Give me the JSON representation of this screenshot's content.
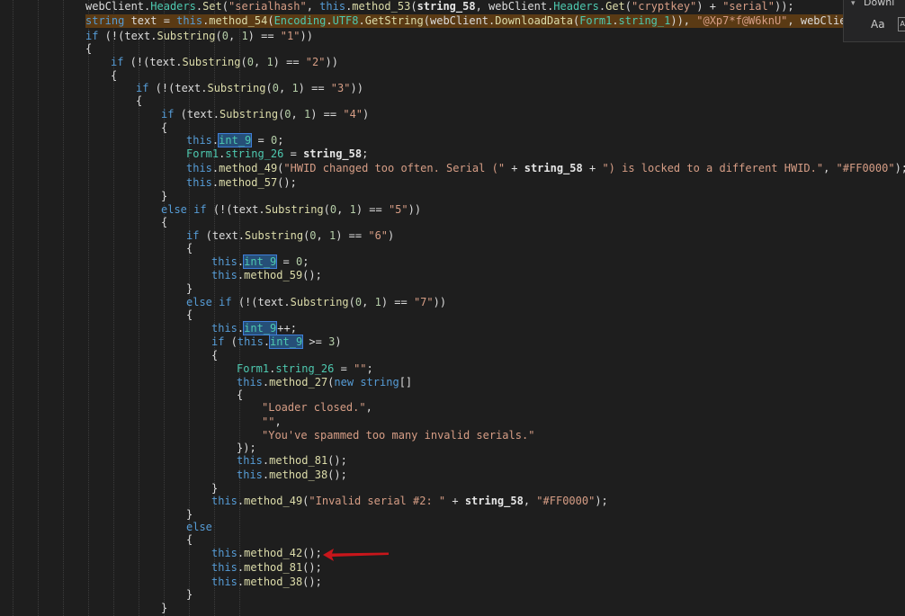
{
  "find_widget": {
    "chevron": "chevron-down-icon",
    "label": "Downl",
    "match_case": "Aa",
    "whole_word": "AB"
  },
  "code": {
    "lines": [
      [
        "webClient",
        ".",
        "Headers",
        ".",
        "Set",
        "(",
        "\"serialhash\"",
        ", ",
        "this",
        ".",
        "method_53",
        "(",
        "string_58",
        ", webClient.",
        "Headers",
        ".",
        "Get",
        "(",
        "\"cryptkey\"",
        ") + ",
        "\"serial\"",
        "));"
      ],
      [
        "string",
        " text = ",
        "this",
        ".",
        "method_54",
        "(",
        "Encoding",
        ".",
        "UTF8",
        ".",
        "GetString",
        "(webClient.",
        "DownloadData",
        "(",
        "Form1",
        ".",
        "string_1",
        ")), ",
        "\"@Xp7*f@W6knU\"",
        ", webClient."
      ],
      [
        "if",
        " (!(text.",
        "Substring",
        "(",
        "0",
        ", ",
        "1",
        ") == ",
        "\"1\"",
        "))"
      ],
      [
        "{"
      ],
      [
        "if",
        " (!(text.",
        "Substring",
        "(",
        "0",
        ", ",
        "1",
        ") == ",
        "\"2\"",
        "))"
      ],
      [
        "{"
      ],
      [
        "if",
        " (!(text.",
        "Substring",
        "(",
        "0",
        ", ",
        "1",
        ") == ",
        "\"3\"",
        "))"
      ],
      [
        "{"
      ],
      [
        "if",
        " (text.",
        "Substring",
        "(",
        "0",
        ", ",
        "1",
        ") == ",
        "\"4\"",
        ")"
      ],
      [
        "{"
      ],
      [
        "this",
        ".",
        "int_9",
        " = ",
        "0",
        ";"
      ],
      [
        "Form1",
        ".",
        "string_26",
        " = ",
        "string_58",
        ";"
      ],
      [
        "this",
        ".",
        "method_49",
        "(",
        "\"HWID changed too often. Serial (\"",
        " + ",
        "string_58",
        " + ",
        "\") is locked to a different HWID.\"",
        ", ",
        "\"#FF0000\"",
        ");"
      ],
      [
        "this",
        ".",
        "method_57",
        "();"
      ],
      [
        "}"
      ],
      [
        "else",
        " ",
        "if",
        " (!(text.",
        "Substring",
        "(",
        "0",
        ", ",
        "1",
        ") == ",
        "\"5\"",
        "))"
      ],
      [
        "{"
      ],
      [
        "if",
        " (text.",
        "Substring",
        "(",
        "0",
        ", ",
        "1",
        ") == ",
        "\"6\"",
        ")"
      ],
      [
        "{"
      ],
      [
        "this",
        ".",
        "int_9",
        " = ",
        "0",
        ";"
      ],
      [
        "this",
        ".",
        "method_59",
        "();"
      ],
      [
        "}"
      ],
      [
        "else",
        " ",
        "if",
        " (!(text.",
        "Substring",
        "(",
        "0",
        ", ",
        "1",
        ") == ",
        "\"7\"",
        "))"
      ],
      [
        "{"
      ],
      [
        "this",
        ".",
        "int_9",
        "++;"
      ],
      [
        "if",
        " (",
        "this",
        ".",
        "int_9",
        " >= ",
        "3",
        ")"
      ],
      [
        "{"
      ],
      [
        "Form1",
        ".",
        "string_26",
        " = ",
        "\"\"",
        ";"
      ],
      [
        "this",
        ".",
        "method_27",
        "(",
        "new",
        " ",
        "string",
        "[]"
      ],
      [
        "{"
      ],
      [
        "\"Loader closed.\"",
        ","
      ],
      [
        "\"\"",
        ","
      ],
      [
        "\"You've spammed too many invalid serials.\""
      ],
      [
        "});"
      ],
      [
        "this",
        ".",
        "method_81",
        "();"
      ],
      [
        "this",
        ".",
        "method_38",
        "();"
      ],
      [
        "}"
      ],
      [
        "this",
        ".",
        "method_49",
        "(",
        "\"Invalid serial #2: \"",
        " + ",
        "string_58",
        ", ",
        "\"#FF0000\"",
        ");"
      ],
      [
        "}"
      ],
      [
        "else"
      ],
      [
        "{"
      ],
      [
        "this",
        ".",
        "method_42",
        "();"
      ],
      [
        "this",
        ".",
        "method_81",
        "();"
      ],
      [
        "this",
        ".",
        "method_38",
        "();"
      ],
      [
        "}"
      ],
      [
        "}"
      ]
    ]
  },
  "annotation": {
    "arrow": "red-arrow-icon",
    "color": "#c8161b"
  }
}
